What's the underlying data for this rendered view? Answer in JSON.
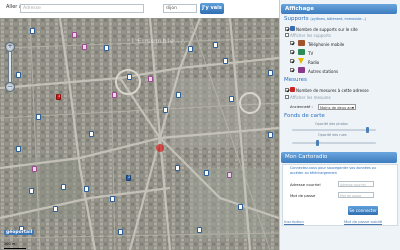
{
  "search": {
    "goto_label": "Aller à",
    "address_placeholder": "Adresse",
    "city_value": "dijon",
    "go_button": "J'y vais",
    "register_button": "S'enregistrer"
  },
  "panel": {
    "title": "Affichage",
    "supports": {
      "heading": "Supports",
      "subheading": "(pylônes, bâtiment, immeuble...)",
      "count_label": "Nombre de supports sur le site",
      "show_label": "Afficher les supports",
      "items": [
        {
          "label": "Téléphonie mobile",
          "checked": true,
          "icon": "mobile-phone-icon"
        },
        {
          "label": "TV",
          "checked": true,
          "icon": "tv-icon"
        },
        {
          "label": "Radio",
          "checked": true,
          "icon": "radio-icon"
        },
        {
          "label": "Autres stations",
          "checked": true,
          "icon": "other-stations-icon"
        }
      ]
    },
    "mesures": {
      "heading": "Mesures",
      "count_label": "Nombre de mesures à cette adresse",
      "show_label": "Afficher les mesures",
      "age_label": "Ancienneté :",
      "age_value": "Moins de deux ans"
    },
    "fonds": {
      "heading": "Fonds de carte",
      "photo_opacity": "Opacité des photos",
      "plan_opacity": "Opacité des rues",
      "photo_opacity_level": 0.9,
      "plan_opacity_level": 0.3
    }
  },
  "account": {
    "title": "Mon Cartoradio",
    "info": "Connectez-vous pour sauvegarder vos données ou accéder au téléchargement",
    "email_label": "Adresse courriel",
    "email_placeholder": "Adresse courriel",
    "password_label": "Mot de passe",
    "password_placeholder": "Mot de passe",
    "connect_button": "Se connecter",
    "signup_link": "Inscription",
    "forgot_link": "Mot de passe oublié"
  },
  "map": {
    "label": "l'Ensemble ...",
    "scale": "200 m",
    "logo": "géoportail",
    "markers": [
      {
        "num": "1"
      },
      {
        "num": "2"
      }
    ]
  },
  "colors": {
    "accent": "#3c7bbe",
    "section_title": "#2a6ebb",
    "marker_red": "#d41b1b"
  }
}
